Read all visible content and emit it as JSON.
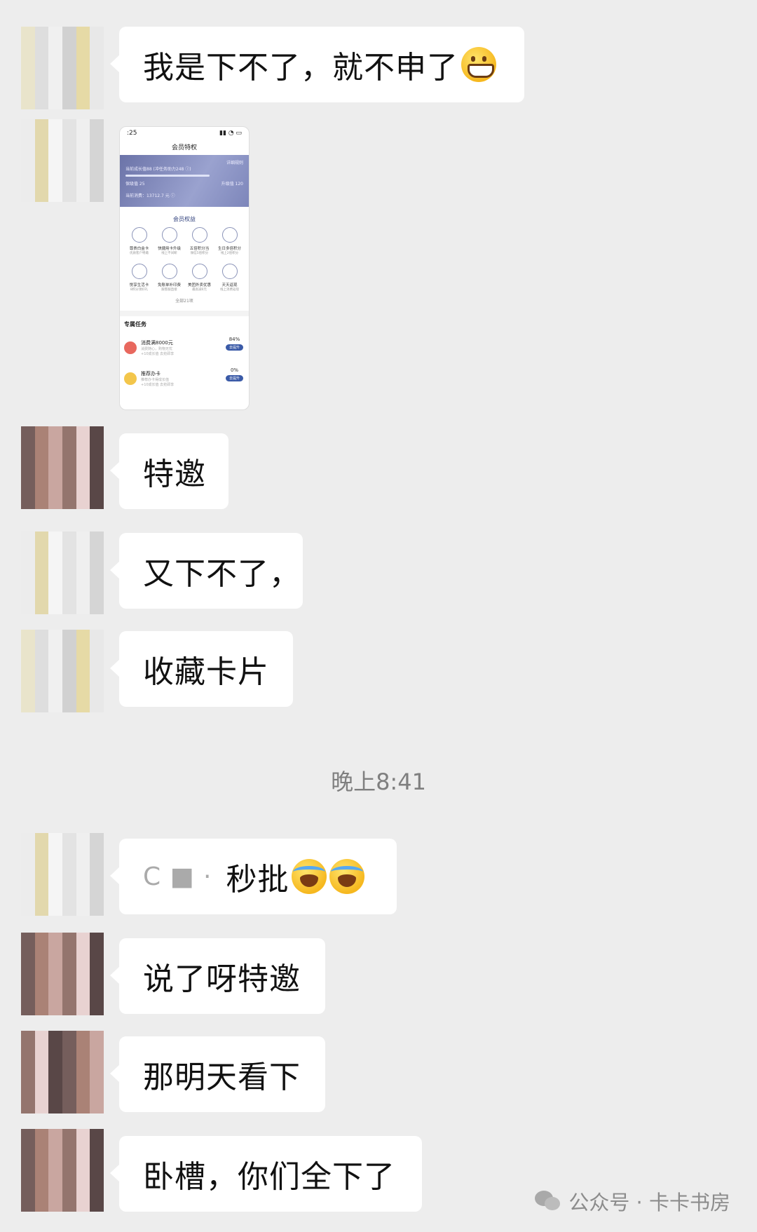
{
  "messages": [
    {
      "text": "我是下不了，就不申了",
      "emoji": "grin-emoji"
    },
    {
      "image_screen": {
        "status_time": ":25",
        "title": "会员特权",
        "rule_link": "详细规则",
        "banner_line1": "当前成长值88 (冲任务助力248 ⓘ)",
        "banner_line2_left": "保级值 25",
        "banner_line2_right": "升级值 120",
        "banner_line3": "当前消费：13712.7 元 ⓘ",
        "section_title": "会员权益",
        "benefits": [
          {
            "label": "尊贵白金卡",
            "sub": "优质客户特邀"
          },
          {
            "label": "快捷用卡升级",
            "sub": "线上不间断"
          },
          {
            "label": "五倍积分当",
            "sub": "微信5倍积分"
          },
          {
            "label": "生日多倍积分",
            "sub": "线上2倍积分"
          },
          {
            "label": "悦享生活卡",
            "sub": "8积分领好礼"
          },
          {
            "label": "免账单补印费",
            "sub": "跟客服直接"
          },
          {
            "label": "美团外卖优惠",
            "sub": "最高减6元"
          },
          {
            "label": "天天返现",
            "sub": "线上消费返现"
          }
        ],
        "more_link": "全部21项",
        "tasks_title": "专属任务",
        "tasks": [
          {
            "title": "消费满8000元",
            "desc": "消费随心，购物无忧",
            "tags": "+10成长值  去抢即享",
            "percent": "84%",
            "button": "去提升"
          },
          {
            "title": "推荐办卡",
            "desc": "推荐办卡得成长值",
            "tags": "+10成长值  去抢即享",
            "percent": "0%",
            "button": "去提升"
          }
        ]
      }
    },
    {
      "text": "特邀"
    },
    {
      "text": "又下不了，"
    },
    {
      "text": "收藏卡片"
    },
    {
      "text": "秒批",
      "prefix": "C  ■  ·",
      "emoji": "cry-emoji"
    },
    {
      "text": "说了呀特邀"
    },
    {
      "text": "那明天看下"
    },
    {
      "text": "卧槽，你们全下了"
    }
  ],
  "timestamp": "晚上8:41",
  "watermark": {
    "text": "公众号 · 卡卡书房"
  },
  "colors": {
    "background": "#ededed",
    "bubble": "#ffffff",
    "text": "#111111"
  }
}
